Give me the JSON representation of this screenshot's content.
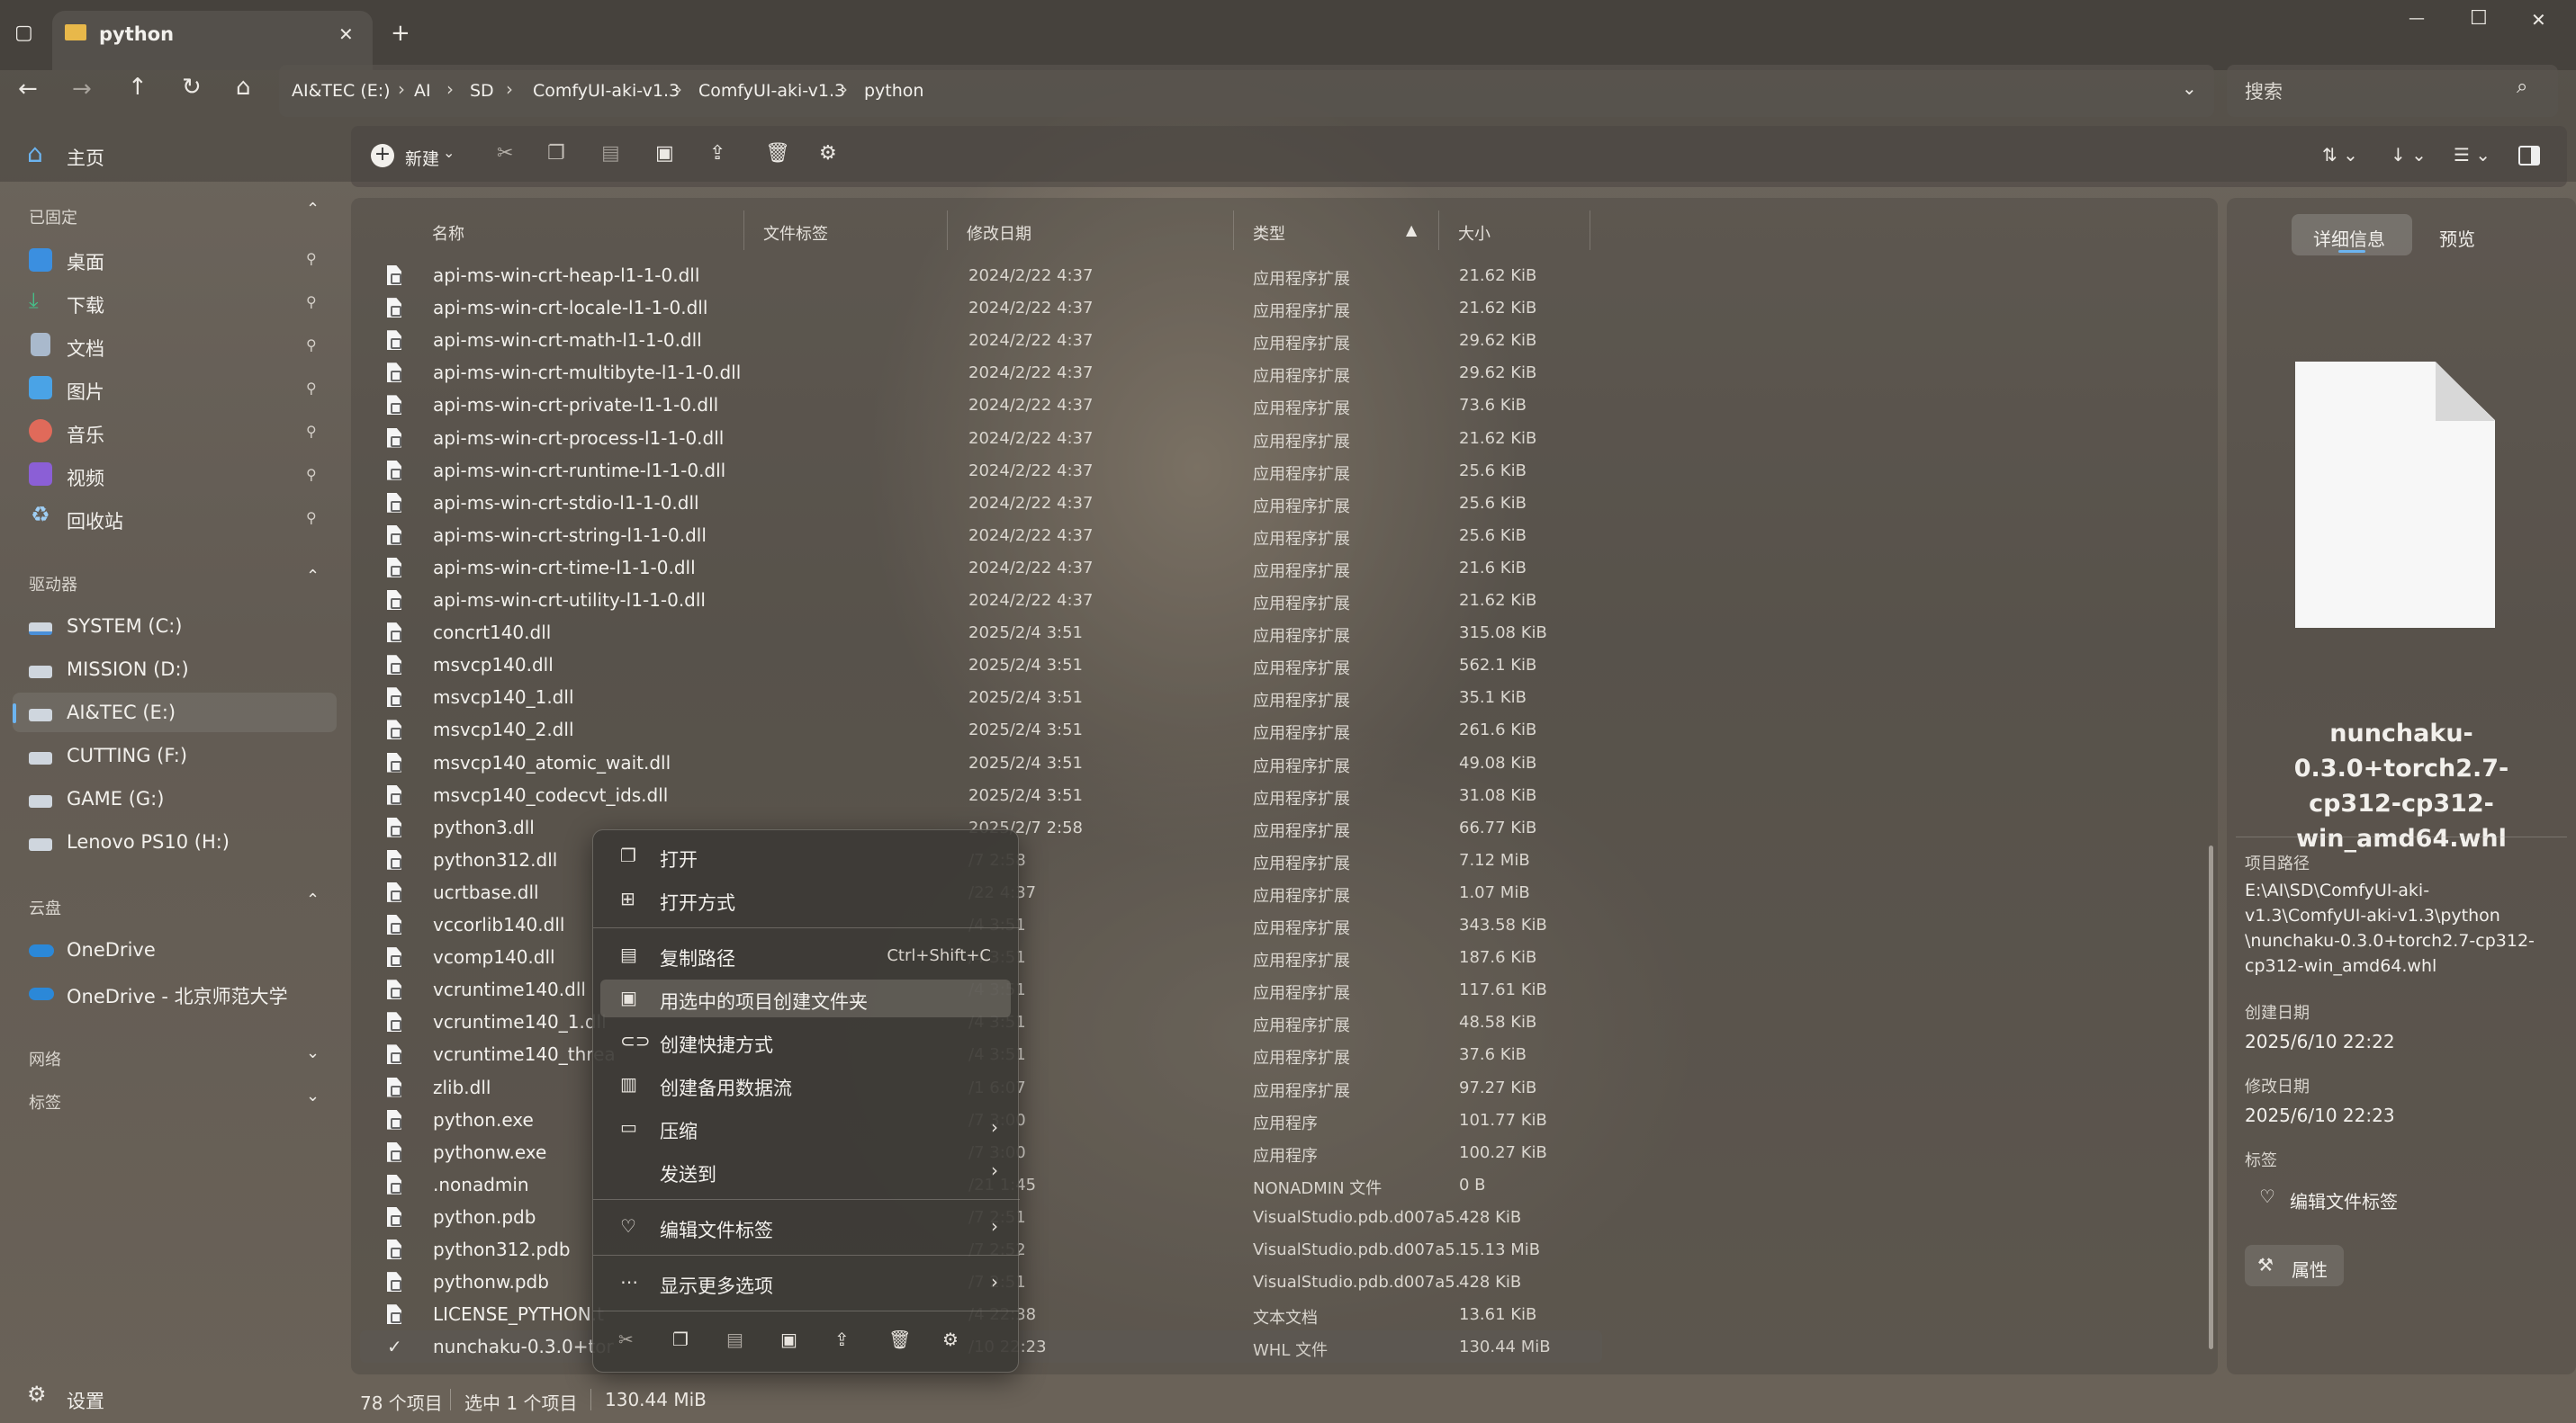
{
  "window": {
    "tab_title": "python",
    "new_tab": "+",
    "minimize": "—",
    "maximize": "☐",
    "close": "✕"
  },
  "address": {
    "crumbs": [
      "AI&TEC (E:)",
      "AI",
      "SD",
      "ComfyUI-aki-v1.3",
      "ComfyUI-aki-v1.3",
      "python"
    ],
    "search_placeholder": "搜索"
  },
  "toolbar": {
    "new_label": "新建"
  },
  "sidebar": {
    "home": "主页",
    "pinned_header": "已固定",
    "pinned": [
      "桌面",
      "下载",
      "文档",
      "图片",
      "音乐",
      "视频",
      "回收站"
    ],
    "drives_header": "驱动器",
    "drives": [
      "SYSTEM (C:)",
      "MISSION (D:)",
      "AI&TEC (E:)",
      "CUTTING (F:)",
      "GAME (G:)",
      "Lenovo PS10 (H:)"
    ],
    "cloud_header": "云盘",
    "cloud": [
      "OneDrive",
      "OneDrive - 北京师范大学"
    ],
    "network_header": "网络",
    "tags_header": "标签",
    "settings": "设置"
  },
  "columns": {
    "name": "名称",
    "tags": "文件标签",
    "modified": "修改日期",
    "type": "类型",
    "size": "大小"
  },
  "files": [
    {
      "name": "api-ms-win-crt-heap-l1-1-0.dll",
      "date": "2024/2/22 4:37",
      "type": "应用程序扩展",
      "size": "21.62 KiB"
    },
    {
      "name": "api-ms-win-crt-locale-l1-1-0.dll",
      "date": "2024/2/22 4:37",
      "type": "应用程序扩展",
      "size": "21.62 KiB"
    },
    {
      "name": "api-ms-win-crt-math-l1-1-0.dll",
      "date": "2024/2/22 4:37",
      "type": "应用程序扩展",
      "size": "29.62 KiB"
    },
    {
      "name": "api-ms-win-crt-multibyte-l1-1-0.dll",
      "date": "2024/2/22 4:37",
      "type": "应用程序扩展",
      "size": "29.62 KiB"
    },
    {
      "name": "api-ms-win-crt-private-l1-1-0.dll",
      "date": "2024/2/22 4:37",
      "type": "应用程序扩展",
      "size": "73.6 KiB"
    },
    {
      "name": "api-ms-win-crt-process-l1-1-0.dll",
      "date": "2024/2/22 4:37",
      "type": "应用程序扩展",
      "size": "21.62 KiB"
    },
    {
      "name": "api-ms-win-crt-runtime-l1-1-0.dll",
      "date": "2024/2/22 4:37",
      "type": "应用程序扩展",
      "size": "25.6 KiB"
    },
    {
      "name": "api-ms-win-crt-stdio-l1-1-0.dll",
      "date": "2024/2/22 4:37",
      "type": "应用程序扩展",
      "size": "25.6 KiB"
    },
    {
      "name": "api-ms-win-crt-string-l1-1-0.dll",
      "date": "2024/2/22 4:37",
      "type": "应用程序扩展",
      "size": "25.6 KiB"
    },
    {
      "name": "api-ms-win-crt-time-l1-1-0.dll",
      "date": "2024/2/22 4:37",
      "type": "应用程序扩展",
      "size": "21.6 KiB"
    },
    {
      "name": "api-ms-win-crt-utility-l1-1-0.dll",
      "date": "2024/2/22 4:37",
      "type": "应用程序扩展",
      "size": "21.62 KiB"
    },
    {
      "name": "concrt140.dll",
      "date": "2025/2/4 3:51",
      "type": "应用程序扩展",
      "size": "315.08 KiB"
    },
    {
      "name": "msvcp140.dll",
      "date": "2025/2/4 3:51",
      "type": "应用程序扩展",
      "size": "562.1 KiB"
    },
    {
      "name": "msvcp140_1.dll",
      "date": "2025/2/4 3:51",
      "type": "应用程序扩展",
      "size": "35.1 KiB"
    },
    {
      "name": "msvcp140_2.dll",
      "date": "2025/2/4 3:51",
      "type": "应用程序扩展",
      "size": "261.6 KiB"
    },
    {
      "name": "msvcp140_atomic_wait.dll",
      "date": "2025/2/4 3:51",
      "type": "应用程序扩展",
      "size": "49.08 KiB"
    },
    {
      "name": "msvcp140_codecvt_ids.dll",
      "date": "2025/2/4 3:51",
      "type": "应用程序扩展",
      "size": "31.08 KiB"
    },
    {
      "name": "python3.dll",
      "date": "2025/2/7 2:58",
      "type": "应用程序扩展",
      "size": "66.77 KiB"
    },
    {
      "name": "python312.dll",
      "date": "/7 2:58",
      "type": "应用程序扩展",
      "size": "7.12 MiB"
    },
    {
      "name": "ucrtbase.dll",
      "date": "/22 4:37",
      "type": "应用程序扩展",
      "size": "1.07 MiB"
    },
    {
      "name": "vccorlib140.dll",
      "date": "/4 3:51",
      "type": "应用程序扩展",
      "size": "343.58 KiB"
    },
    {
      "name": "vcomp140.dll",
      "date": "/4 3:51",
      "type": "应用程序扩展",
      "size": "187.6 KiB"
    },
    {
      "name": "vcruntime140.dll",
      "date": "/4 3:51",
      "type": "应用程序扩展",
      "size": "117.61 KiB"
    },
    {
      "name": "vcruntime140_1.dll",
      "date": "/4 3:51",
      "type": "应用程序扩展",
      "size": "48.58 KiB"
    },
    {
      "name": "vcruntime140_threa",
      "date": "/4 3:51",
      "type": "应用程序扩展",
      "size": "37.6 KiB"
    },
    {
      "name": "zlib.dll",
      "date": "/1 6:07",
      "type": "应用程序扩展",
      "size": "97.27 KiB"
    },
    {
      "name": "python.exe",
      "date": "/7 3:00",
      "type": "应用程序",
      "size": "101.77 KiB"
    },
    {
      "name": "pythonw.exe",
      "date": "/7 3:00",
      "type": "应用程序",
      "size": "100.27 KiB"
    },
    {
      "name": ".nonadmin",
      "date": "/21 1:45",
      "type": "NONADMIN 文件",
      "size": "0 B"
    },
    {
      "name": "python.pdb",
      "date": "/7 2:51",
      "type": "VisualStudio.pdb.d007a5...",
      "size": "428 KiB"
    },
    {
      "name": "python312.pdb",
      "date": "/7 2:52",
      "type": "VisualStudio.pdb.d007a5...",
      "size": "15.13 MiB"
    },
    {
      "name": "pythonw.pdb",
      "date": "/7 2:51",
      "type": "VisualStudio.pdb.d007a5...",
      "size": "428 KiB"
    },
    {
      "name": "LICENSE_PYTHON.t",
      "date": "/4 22:38",
      "type": "文本文档",
      "size": "13.61 KiB"
    },
    {
      "name": "nunchaku-0.3.0+tor",
      "date": "/10 22:23",
      "type": "WHL 文件",
      "size": "130.44 MiB"
    }
  ],
  "context_menu": {
    "open": "打开",
    "open_with": "打开方式",
    "copy_path": "复制路径",
    "copy_path_shortcut": "Ctrl+Shift+C",
    "new_folder_with_selection": "用选中的项目创建文件夹",
    "create_shortcut": "创建快捷方式",
    "create_alt_stream": "创建备用数据流",
    "compress": "压缩",
    "send_to": "发送到",
    "edit_tags": "编辑文件标签",
    "more_options": "显示更多选项"
  },
  "details": {
    "tab_details": "详细信息",
    "tab_preview": "预览",
    "filename": "nunchaku-0.3.0+torch2.7-cp312-cp312-win_amd64.whl",
    "filename_lines": [
      "nunchaku-0.3.0+torch2.7-",
      "cp312-cp312-",
      "win_amd64.whl"
    ],
    "path_label": "项目路径",
    "path_lines": [
      "E:\\AI\\SD\\ComfyUI-aki-",
      "v1.3\\ComfyUI-aki-v1.3\\python",
      "\\nunchaku-0.3.0+torch2.7-cp312-",
      "cp312-win_amd64.whl"
    ],
    "created_label": "创建日期",
    "created": "2025/6/10 22:22",
    "modified_label": "修改日期",
    "modified": "2025/6/10 22:23",
    "tags_label": "标签",
    "edit_tags": "编辑文件标签",
    "properties": "属性"
  },
  "status": {
    "count": "78 个项目",
    "selected": "选中 1 个项目",
    "size": "130.44 MiB"
  },
  "colors": {
    "accent_blue": "#3b8fe0",
    "selected_row": "#5c5852"
  }
}
